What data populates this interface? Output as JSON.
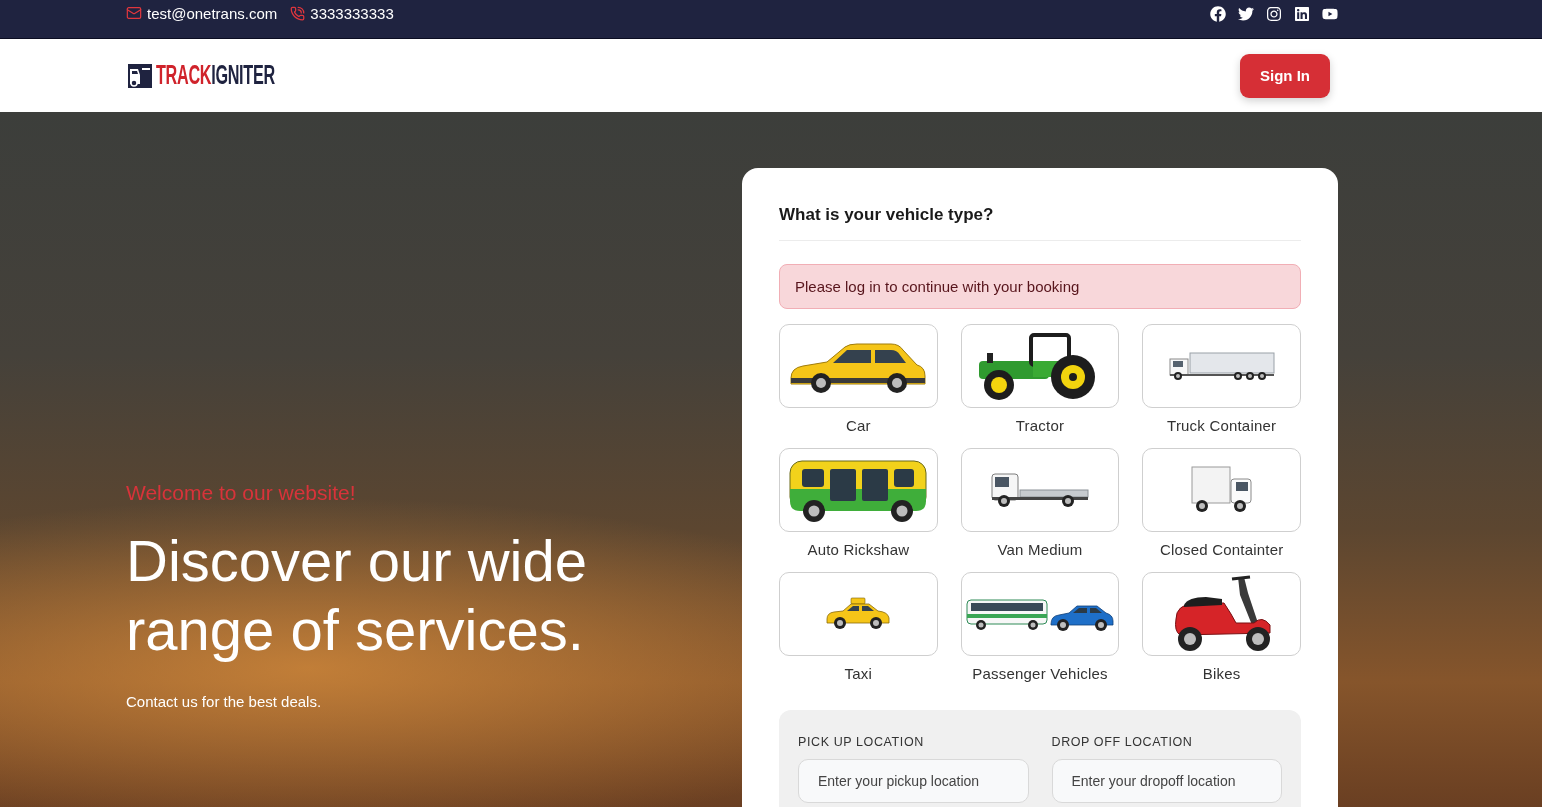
{
  "top_bar": {
    "email": "test@onetrans.com",
    "phone": "3333333333"
  },
  "header": {
    "logo": {
      "part_1": "TRACK",
      "part_2": "IGNITER"
    },
    "sign_in_button": "Sign In"
  },
  "hero": {
    "welcome": "Welcome to our website!",
    "heading": "Discover our wide range of services.",
    "subtext": "Contact us for the best deals."
  },
  "booking_card": {
    "title": "What is your vehicle type?",
    "alert": "Please log in to continue with your booking",
    "vehicles": [
      {
        "label": "Car",
        "kind": "car",
        "selected": false
      },
      {
        "label": "Tractor",
        "kind": "tractor",
        "selected": false
      },
      {
        "label": "Truck Container",
        "kind": "container_truck",
        "selected": false
      },
      {
        "label": "Auto Rickshaw",
        "kind": "rickshaw",
        "selected": false
      },
      {
        "label": "Van Medium",
        "kind": "flatbed",
        "selected": false
      },
      {
        "label": "Closed Containter",
        "kind": "box_truck",
        "selected": false
      },
      {
        "label": "Taxi",
        "kind": "taxi",
        "selected": false
      },
      {
        "label": "Passenger Vehicles",
        "kind": "bus_and_car",
        "selected": false
      },
      {
        "label": "Bikes",
        "kind": "scooter",
        "selected": false
      }
    ],
    "pickup": {
      "label": "PICK UP LOCATION",
      "placeholder": "Enter your pickup location"
    },
    "dropoff": {
      "label": "DROP OFF LOCATION",
      "placeholder": "Enter your dropoff location"
    }
  }
}
